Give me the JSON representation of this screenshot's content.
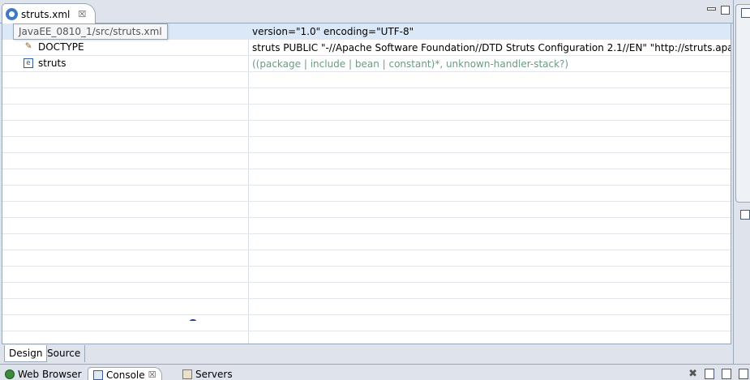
{
  "editor_tab": {
    "title": "struts.xml",
    "close": "☒"
  },
  "tooltip": "JavaEE_0810_1/src/struts.xml",
  "rows": [
    {
      "node": "",
      "value": "version=\"1.0\" encoding=\"UTF-8\""
    },
    {
      "node": "DOCTYPE",
      "value": "struts PUBLIC \"-//Apache Software Foundation//DTD Struts Configuration 2.1//EN\" \"http://struts.apach"
    },
    {
      "node": "struts",
      "icon_letter": "e",
      "value": "((package | include | bean | constant)*, unknown-handler-stack?)"
    }
  ],
  "bottom_tabs": {
    "design": "Design",
    "source": "Source"
  },
  "views": {
    "web_browser": "Web Browser",
    "console": "Console",
    "servers": "Servers",
    "close": "☒"
  },
  "colors": {
    "selection": "#dbe8f7",
    "muted_value": "#6b9a86",
    "border": "#98a8bc"
  }
}
